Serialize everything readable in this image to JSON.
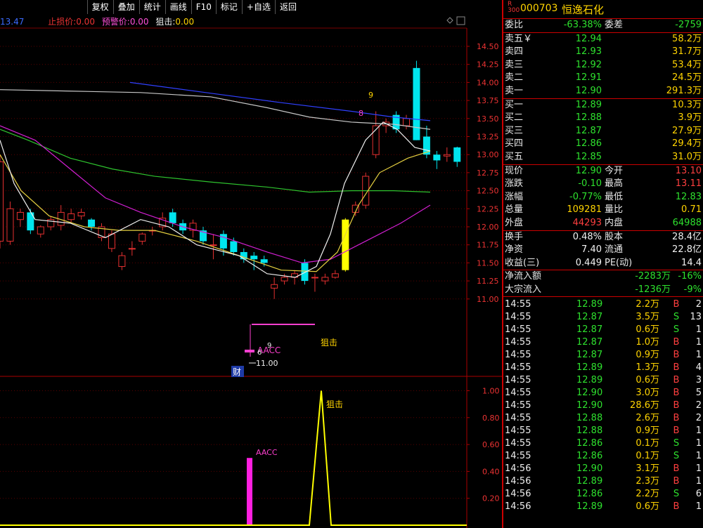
{
  "toolbar": [
    "复权",
    "叠加",
    "统计",
    "画线",
    "F10",
    "标记",
    "+自选",
    "返回"
  ],
  "indicators": {
    "ma_value": "13.47",
    "stop_label": "止损价:",
    "stop_value": "0.00",
    "warn_label": "预警价:",
    "warn_value": "0.00",
    "snipe_label": "狙击:",
    "snipe_value": "0.00"
  },
  "price_axis": [
    "14.50",
    "14.25",
    "14.00",
    "13.75",
    "13.50",
    "13.25",
    "13.00",
    "12.75",
    "12.50",
    "12.25",
    "12.00",
    "11.75",
    "11.50",
    "11.25",
    "11.00"
  ],
  "sub_axis": [
    "1.00",
    "0.80",
    "0.60",
    "0.40",
    "0.20"
  ],
  "annotations": {
    "low_price": "11.00",
    "caibao": "财",
    "aacc": "AACC",
    "snipe": "狙击",
    "sub_aacc": "AACC",
    "sub_snipe": "狙击",
    "nine_a": "9",
    "nine_b": "9",
    "eight": "8",
    "six": "6"
  },
  "stock": {
    "badge": "R\n300",
    "code": "000703",
    "name": "恒逸石化"
  },
  "weibi": {
    "label": "委比",
    "value": "-63.38%",
    "label2": "委差",
    "value2": "-2759"
  },
  "asks": [
    {
      "label": "卖五",
      "sym": "￥",
      "price": "12.94",
      "vol": "58.2万"
    },
    {
      "label": "卖四",
      "sym": "",
      "price": "12.93",
      "vol": "31.7万"
    },
    {
      "label": "卖三",
      "sym": "",
      "price": "12.92",
      "vol": "53.4万"
    },
    {
      "label": "卖二",
      "sym": "",
      "price": "12.91",
      "vol": "24.5万"
    },
    {
      "label": "卖一",
      "sym": "",
      "price": "12.90",
      "vol": "291.3万"
    }
  ],
  "bids": [
    {
      "label": "买一",
      "price": "12.89",
      "vol": "10.3万"
    },
    {
      "label": "买二",
      "price": "12.88",
      "vol": "3.9万"
    },
    {
      "label": "买三",
      "price": "12.87",
      "vol": "27.9万"
    },
    {
      "label": "买四",
      "price": "12.86",
      "vol": "29.4万"
    },
    {
      "label": "买五",
      "price": "12.85",
      "vol": "31.0万"
    }
  ],
  "quote": [
    {
      "l1": "现价",
      "v1": "12.90",
      "c1": "green",
      "l2": "今开",
      "v2": "13.10",
      "c2": "red"
    },
    {
      "l1": "涨跌",
      "v1": "-0.10",
      "c1": "green",
      "l2": "最高",
      "v2": "13.11",
      "c2": "red"
    },
    {
      "l1": "涨幅",
      "v1": "-0.77%",
      "c1": "green",
      "l2": "最低",
      "v2": "12.83",
      "c2": "green"
    },
    {
      "l1": "总量",
      "v1": "109281",
      "c1": "yellow",
      "l2": "量比",
      "v2": "0.71",
      "c2": "yellow"
    },
    {
      "l1": "外盘",
      "v1": "44293",
      "c1": "red",
      "l2": "内盘",
      "v2": "64988",
      "c2": "green"
    }
  ],
  "stats": [
    {
      "l1": "换手",
      "v1": "0.48%",
      "l2": "股本",
      "v2": "28.4亿"
    },
    {
      "l1": "净资",
      "v1": "7.40",
      "l2": "流通",
      "v2": "22.8亿"
    },
    {
      "l1": "收益(三)",
      "v1": "0.449",
      "l2": "PE(动)",
      "v2": "14.4"
    }
  ],
  "flows": [
    {
      "label": "净流入额",
      "v": "-2283万",
      "p": "-16%"
    },
    {
      "label": "大宗流入",
      "v": "-1236万",
      "p": "-9%"
    }
  ],
  "ticks": [
    {
      "t": "14:55",
      "p": "12.89",
      "v": "2.2万",
      "s": "B",
      "n": "2"
    },
    {
      "t": "14:55",
      "p": "12.87",
      "v": "3.5万",
      "s": "S",
      "n": "13"
    },
    {
      "t": "14:55",
      "p": "12.87",
      "v": "0.6万",
      "s": "S",
      "n": "1"
    },
    {
      "t": "14:55",
      "p": "12.87",
      "v": "1.0万",
      "s": "B",
      "n": "1"
    },
    {
      "t": "14:55",
      "p": "12.87",
      "v": "0.9万",
      "s": "B",
      "n": "1"
    },
    {
      "t": "14:55",
      "p": "12.89",
      "v": "1.3万",
      "s": "B",
      "n": "4"
    },
    {
      "t": "14:55",
      "p": "12.89",
      "v": "0.6万",
      "s": "B",
      "n": "3"
    },
    {
      "t": "14:55",
      "p": "12.90",
      "v": "3.0万",
      "s": "B",
      "n": "5"
    },
    {
      "t": "14:55",
      "p": "12.90",
      "v": "28.6万",
      "s": "B",
      "n": "2"
    },
    {
      "t": "14:55",
      "p": "12.88",
      "v": "2.6万",
      "s": "B",
      "n": "2"
    },
    {
      "t": "14:55",
      "p": "12.88",
      "v": "0.9万",
      "s": "B",
      "n": "1"
    },
    {
      "t": "14:55",
      "p": "12.86",
      "v": "0.1万",
      "s": "S",
      "n": "1"
    },
    {
      "t": "14:55",
      "p": "12.86",
      "v": "0.1万",
      "s": "S",
      "n": "1"
    },
    {
      "t": "14:56",
      "p": "12.90",
      "v": "3.1万",
      "s": "B",
      "n": "1"
    },
    {
      "t": "14:56",
      "p": "12.89",
      "v": "2.3万",
      "s": "B",
      "n": "1"
    },
    {
      "t": "14:56",
      "p": "12.86",
      "v": "2.2万",
      "s": "S",
      "n": "6"
    },
    {
      "t": "14:56",
      "p": "12.89",
      "v": "0.6万",
      "s": "B",
      "n": "1"
    }
  ],
  "chart_data": {
    "type": "candlestick",
    "ylim": [
      10.9,
      14.6
    ],
    "candles": [
      {
        "o": 11.8,
        "c": 12.9,
        "h": 13.0,
        "l": 11.7
      },
      {
        "o": 11.8,
        "c": 12.25,
        "h": 12.35,
        "l": 11.75
      },
      {
        "o": 12.1,
        "c": 12.2,
        "h": 12.25,
        "l": 12.0
      },
      {
        "o": 12.2,
        "c": 11.95,
        "h": 12.25,
        "l": 11.9
      },
      {
        "o": 11.9,
        "c": 12.0,
        "h": 12.02,
        "l": 11.85
      },
      {
        "o": 12.0,
        "c": 12.1,
        "h": 12.15,
        "l": 11.95
      },
      {
        "o": 12.02,
        "c": 12.2,
        "h": 12.3,
        "l": 11.95
      },
      {
        "o": 12.1,
        "c": 12.18,
        "h": 12.25,
        "l": 12.05
      },
      {
        "o": 12.15,
        "c": 12.2,
        "h": 12.25,
        "l": 12.1
      },
      {
        "o": 12.1,
        "c": 12.0,
        "h": 12.12,
        "l": 11.95
      },
      {
        "o": 11.85,
        "c": 12.0,
        "h": 12.05,
        "l": 11.8
      },
      {
        "o": 11.7,
        "c": 11.9,
        "h": 11.95,
        "l": 11.65
      },
      {
        "o": 11.45,
        "c": 11.6,
        "h": 11.65,
        "l": 11.4
      },
      {
        "o": 11.7,
        "c": 11.7,
        "h": 11.8,
        "l": 11.6
      },
      {
        "o": 11.8,
        "c": 11.9,
        "h": 11.92,
        "l": 11.75
      },
      {
        "o": 11.95,
        "c": 11.95,
        "h": 12.0,
        "l": 11.88
      },
      {
        "o": 12.0,
        "c": 12.12,
        "h": 12.2,
        "l": 11.95
      },
      {
        "o": 12.2,
        "c": 12.05,
        "h": 12.25,
        "l": 12.0
      },
      {
        "o": 12.05,
        "c": 11.95,
        "h": 12.1,
        "l": 11.9
      },
      {
        "o": 11.95,
        "c": 12.05,
        "h": 12.1,
        "l": 11.85
      },
      {
        "o": 11.95,
        "c": 11.8,
        "h": 12.0,
        "l": 11.75
      },
      {
        "o": 11.75,
        "c": 11.75,
        "h": 11.9,
        "l": 11.55
      },
      {
        "o": 11.9,
        "c": 11.7,
        "h": 11.95,
        "l": 11.6
      },
      {
        "o": 11.8,
        "c": 11.65,
        "h": 11.85,
        "l": 11.6
      },
      {
        "o": 11.65,
        "c": 11.55,
        "h": 11.7,
        "l": 11.5
      },
      {
        "o": 11.6,
        "c": 11.55,
        "h": 11.65,
        "l": 11.4
      },
      {
        "o": 11.55,
        "c": 11.5,
        "h": 11.6,
        "l": 11.45
      },
      {
        "o": 11.15,
        "c": 11.2,
        "h": 11.3,
        "l": 11.0
      },
      {
        "o": 11.25,
        "c": 11.3,
        "h": 11.35,
        "l": 11.2
      },
      {
        "o": 11.3,
        "c": 11.35,
        "h": 11.4,
        "l": 11.2
      },
      {
        "o": 11.5,
        "c": 11.25,
        "h": 11.55,
        "l": 11.2
      },
      {
        "o": 11.3,
        "c": 11.3,
        "h": 11.35,
        "l": 11.1
      },
      {
        "o": 11.25,
        "c": 11.3,
        "h": 11.35,
        "l": 11.2
      },
      {
        "o": 11.3,
        "c": 11.35,
        "h": 11.4,
        "l": 11.28
      },
      {
        "o": 11.4,
        "c": 12.1,
        "h": 12.12,
        "l": 11.38
      },
      {
        "o": 12.2,
        "c": 12.3,
        "h": 12.35,
        "l": 12.15
      },
      {
        "o": 12.3,
        "c": 12.7,
        "h": 12.75,
        "l": 12.25
      },
      {
        "o": 13.0,
        "c": 13.4,
        "h": 13.6,
        "l": 12.95
      },
      {
        "o": 13.4,
        "c": 13.45,
        "h": 13.5,
        "l": 13.3
      },
      {
        "o": 13.55,
        "c": 13.35,
        "h": 13.6,
        "l": 13.3
      },
      {
        "o": 13.4,
        "c": 13.5,
        "h": 13.55,
        "l": 13.35
      },
      {
        "o": 14.2,
        "c": 13.2,
        "h": 14.3,
        "l": 13.2
      },
      {
        "o": 13.25,
        "c": 13.0,
        "h": 13.4,
        "l": 12.95
      },
      {
        "o": 13.0,
        "c": 12.92,
        "h": 13.05,
        "l": 12.8
      },
      {
        "o": 12.98,
        "c": 13.0,
        "h": 13.1,
        "l": 12.9
      },
      {
        "o": 13.1,
        "c": 12.9,
        "h": 13.11,
        "l": 12.83
      }
    ]
  }
}
